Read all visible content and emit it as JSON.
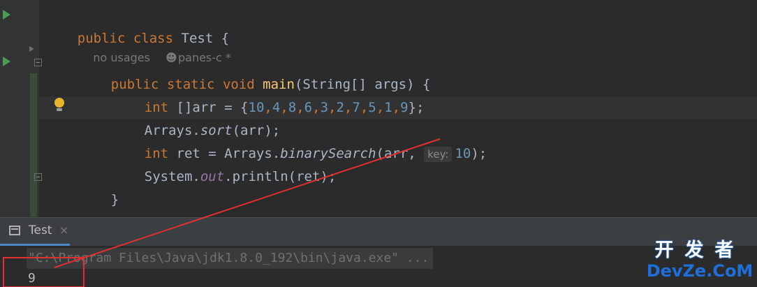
{
  "editor": {
    "lines": {
      "class_kw1": "public",
      "class_kw2": "class",
      "class_name": "Test",
      "class_brace": "{",
      "main_kw1": "public",
      "main_kw2": "static",
      "main_kw3": "void",
      "main_name": "main",
      "main_params": "(String[] args) {",
      "arr_kw": "int",
      "arr_rest": "[]arr = {",
      "arr_values": [
        "10",
        "4",
        "8",
        "6",
        "3",
        "2",
        "7",
        "5",
        "1",
        "9"
      ],
      "arr_close": "};",
      "sort_obj": "Arrays.",
      "sort_method": "sort",
      "sort_args": "(arr);",
      "ret_kw": "int",
      "ret_mid": "ret = Arrays.",
      "ret_method": "binarySearch",
      "ret_args": "(arr,",
      "ret_hint": "key:",
      "ret_key": "10",
      "ret_close": ");",
      "print_obj": "System.",
      "print_field": "out",
      "print_rest": ".println(ret);",
      "close_method": "}",
      "close_class": "}"
    },
    "lens": {
      "usages": "no usages",
      "author": "panes-c *"
    }
  },
  "run_panel": {
    "tab_label": "Test",
    "tab_close": "×",
    "command": "\"C:\\Program Files\\Java\\jdk1.8.0_192\\bin\\java.exe\" ...",
    "output": "9"
  },
  "watermark": {
    "top": "开发者",
    "bottom": "DevZe.CoM"
  },
  "colors": {
    "annotation": "#e03030",
    "accent": "#4a88c7",
    "keyword": "#cc7832",
    "number": "#6897bb",
    "method": "#ffc66d"
  },
  "icons": [
    "run-icon",
    "fold-icon",
    "bulb-icon",
    "user-icon",
    "console-tab-icon",
    "close-icon"
  ]
}
